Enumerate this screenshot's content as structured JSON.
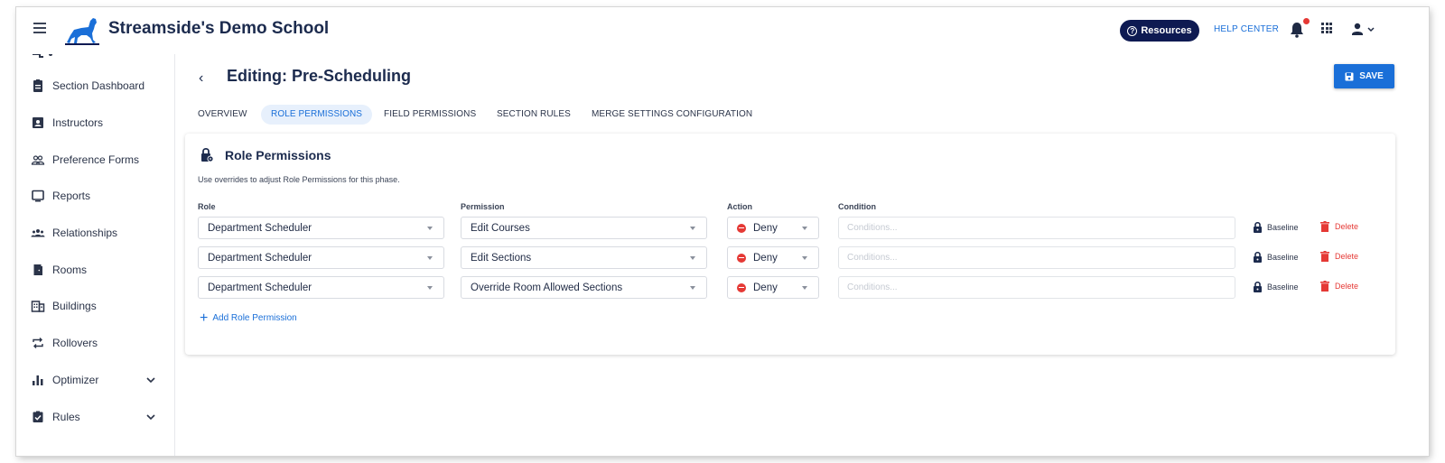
{
  "header": {
    "app_title": "Streamside's Demo School",
    "resources_label": "Resources",
    "help_center_label": "HELP CENTER",
    "notification_dot_color": "#e53935",
    "brand_color": "#0e1a52",
    "accent_color": "#1a6fd8"
  },
  "sidebar": {
    "items": [
      {
        "label": "Section Dashboard",
        "icon": "clipboard-icon"
      },
      {
        "label": "Instructors",
        "icon": "id-card-icon"
      },
      {
        "label": "Preference Forms",
        "icon": "people-outline-icon"
      },
      {
        "label": "Reports",
        "icon": "monitor-icon"
      },
      {
        "label": "Relationships",
        "icon": "group-icon"
      },
      {
        "label": "Rooms",
        "icon": "door-icon"
      },
      {
        "label": "Buildings",
        "icon": "building-icon"
      },
      {
        "label": "Rollovers",
        "icon": "repeat-icon"
      },
      {
        "label": "Optimizer",
        "icon": "bar-chart-icon"
      },
      {
        "label": "Rules",
        "icon": "checklist-icon"
      }
    ]
  },
  "page": {
    "back_symbol": "‹",
    "title": "Editing: Pre-Scheduling",
    "save_label": "SAVE"
  },
  "tabs": [
    {
      "label": "OVERVIEW"
    },
    {
      "label": "ROLE PERMISSIONS",
      "active": true
    },
    {
      "label": "FIELD PERMISSIONS"
    },
    {
      "label": "SECTION RULES"
    },
    {
      "label": "MERGE SETTINGS CONFIGURATION"
    }
  ],
  "card": {
    "title": "Role Permissions",
    "description": "Use overrides to adjust Role Permissions for this phase.",
    "columns": {
      "role": "Role",
      "permission": "Permission",
      "action": "Action",
      "condition": "Condition"
    },
    "rows": [
      {
        "role": "Department Scheduler",
        "permission": "Edit Courses",
        "action": "Deny",
        "condition_placeholder": "Conditions...",
        "baseline": "Baseline",
        "delete": "Delete"
      },
      {
        "role": "Department Scheduler",
        "permission": "Edit Sections",
        "action": "Deny",
        "condition_placeholder": "Conditions...",
        "baseline": "Baseline",
        "delete": "Delete"
      },
      {
        "role": "Department Scheduler",
        "permission": "Override Room Allowed Sections",
        "action": "Deny",
        "condition_placeholder": "Conditions...",
        "baseline": "Baseline",
        "delete": "Delete"
      }
    ],
    "add_label": "Add Role Permission"
  }
}
